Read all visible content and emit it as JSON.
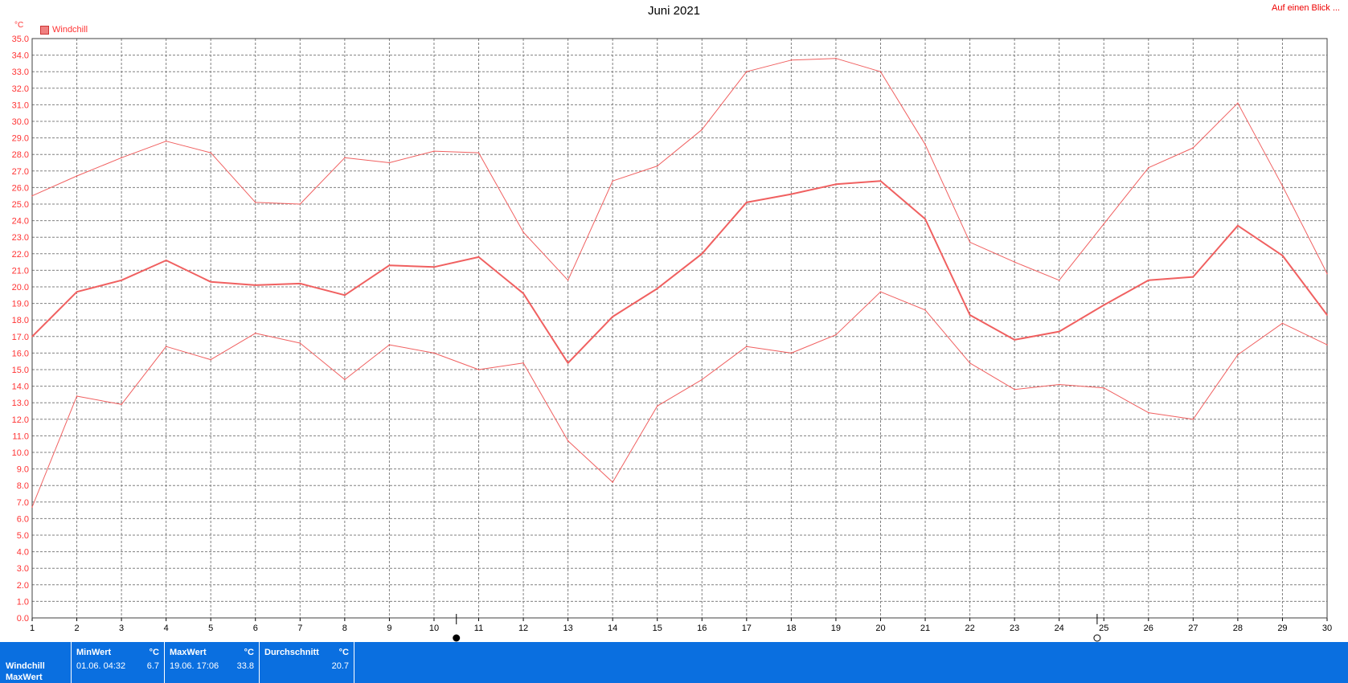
{
  "header": {
    "title": "Juni 2021",
    "link": "Auf einen Blick ..."
  },
  "colors": {
    "line": "#f06060",
    "grid": "#808080",
    "axis_text": "#ff3333",
    "stats_bg": "#0a6fe0"
  },
  "chart_data": {
    "type": "line",
    "title": "Juni 2021",
    "ylabel": "°C",
    "legend": [
      "Windchill"
    ],
    "legend_position": "top-left",
    "grid": true,
    "x": [
      1,
      2,
      3,
      4,
      5,
      6,
      7,
      8,
      9,
      10,
      11,
      12,
      13,
      14,
      15,
      16,
      17,
      18,
      19,
      20,
      21,
      22,
      23,
      24,
      25,
      26,
      27,
      28,
      29,
      30
    ],
    "xlim": [
      1,
      30
    ],
    "ylim": [
      0,
      35
    ],
    "ytick_step": 1,
    "series": [
      {
        "role": "max",
        "width": 1,
        "values": [
          25.5,
          26.7,
          27.8,
          28.8,
          28.1,
          25.1,
          25.0,
          27.8,
          27.5,
          28.2,
          28.1,
          23.3,
          20.4,
          26.4,
          27.3,
          29.5,
          33.0,
          33.7,
          33.8,
          33.0,
          28.6,
          22.7,
          21.5,
          20.4,
          23.8,
          27.2,
          28.4,
          31.1,
          26.1,
          20.8
        ]
      },
      {
        "role": "avg",
        "width": 2,
        "values": [
          17.0,
          19.7,
          20.4,
          21.6,
          20.3,
          20.1,
          20.2,
          19.5,
          21.3,
          21.2,
          21.8,
          19.6,
          15.4,
          18.2,
          19.9,
          22.0,
          25.1,
          25.6,
          26.2,
          26.4,
          24.1,
          18.3,
          16.8,
          17.3,
          18.9,
          20.4,
          20.6,
          23.7,
          21.9,
          18.3
        ]
      },
      {
        "role": "min",
        "width": 1,
        "values": [
          6.7,
          13.4,
          12.9,
          16.4,
          15.6,
          17.2,
          16.6,
          14.4,
          16.5,
          16.0,
          15.0,
          15.4,
          10.7,
          8.2,
          12.8,
          14.4,
          16.4,
          16.0,
          17.1,
          19.7,
          18.6,
          15.4,
          13.8,
          14.1,
          13.9,
          12.4,
          12.0,
          15.9,
          17.8,
          16.5
        ]
      }
    ],
    "markers": [
      {
        "x": 10.5,
        "style": "filled"
      },
      {
        "x": 24.85,
        "style": "hollow"
      }
    ]
  },
  "stats": {
    "row_labels": [
      "Windchill",
      "MaxWert"
    ],
    "cols": [
      {
        "header": "MinWert",
        "unit": "°C",
        "date": "01.06.  04:32",
        "value": "6.7"
      },
      {
        "header": "MaxWert",
        "unit": "°C",
        "date": "19.06.  17:06",
        "value": "33.8"
      },
      {
        "header": "Durchschnitt",
        "unit": "°C",
        "date": "",
        "value": "20.7"
      }
    ]
  }
}
